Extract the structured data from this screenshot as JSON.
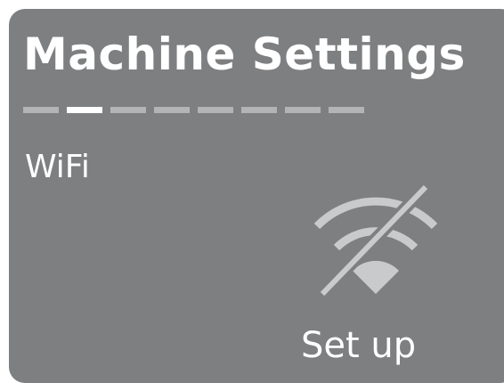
{
  "header": {
    "title": "Machine Settings"
  },
  "pager": {
    "total_pages": 8,
    "current_page": 2
  },
  "setting": {
    "label": "WiFi",
    "status_icon": "wifi-off-icon",
    "action_label": "Set up"
  },
  "colors": {
    "background": "#7e7f81",
    "text": "#ffffff",
    "pager_inactive": "#b3b4b6",
    "pager_active": "#ffffff",
    "icon": "#c9cacc"
  }
}
